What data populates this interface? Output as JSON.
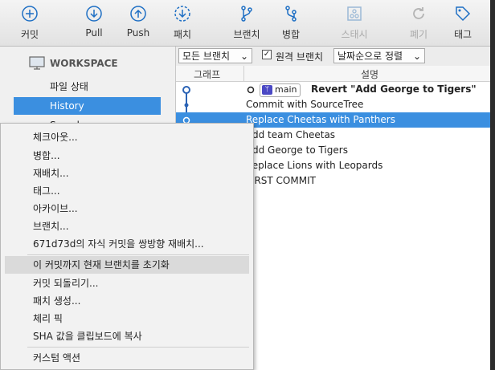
{
  "toolbar": {
    "commit": "커밋",
    "pull": "Pull",
    "push": "Push",
    "fetch": "패치",
    "branch": "브랜치",
    "merge": "병합",
    "stash": "스태시",
    "discard": "폐기",
    "tag": "태그"
  },
  "sidebar": {
    "workspace": "WORKSPACE",
    "file_status": "파일 상태",
    "history": "History",
    "search": "Search"
  },
  "filter": {
    "branches": "모든 브랜치",
    "remote_checked": true,
    "remote_label": "원격 브랜치",
    "sort": "날짜순으로 정렬"
  },
  "table": {
    "col_graph": "그래프",
    "col_desc": "설명",
    "head_branch": "main",
    "rows": [
      "Revert \"Add George to Tigers\"",
      "Commit with SourceTree",
      "Replace Cheetas with Panthers",
      "Add team Cheetas",
      "Add George to Tigers",
      "Replace Lions with Leopards",
      "FIRST COMMIT"
    ]
  },
  "menu": {
    "items": [
      "체크아웃...",
      "병합...",
      "재배치...",
      "태그...",
      "아카이브...",
      "브랜치...",
      "671d73d의 자식 커밋을 쌍방향 재배치...",
      "이 커밋까지 현재 브랜치를 초기화",
      "커밋 되돌리기...",
      "패치 생성...",
      "체리 픽",
      "SHA 값을 클립보드에 복사",
      "커스텀 액션"
    ]
  },
  "colors": {
    "selection": "#3b8fe0",
    "icon": "#1e6fc4",
    "branch_badge": "#4a48c4"
  }
}
